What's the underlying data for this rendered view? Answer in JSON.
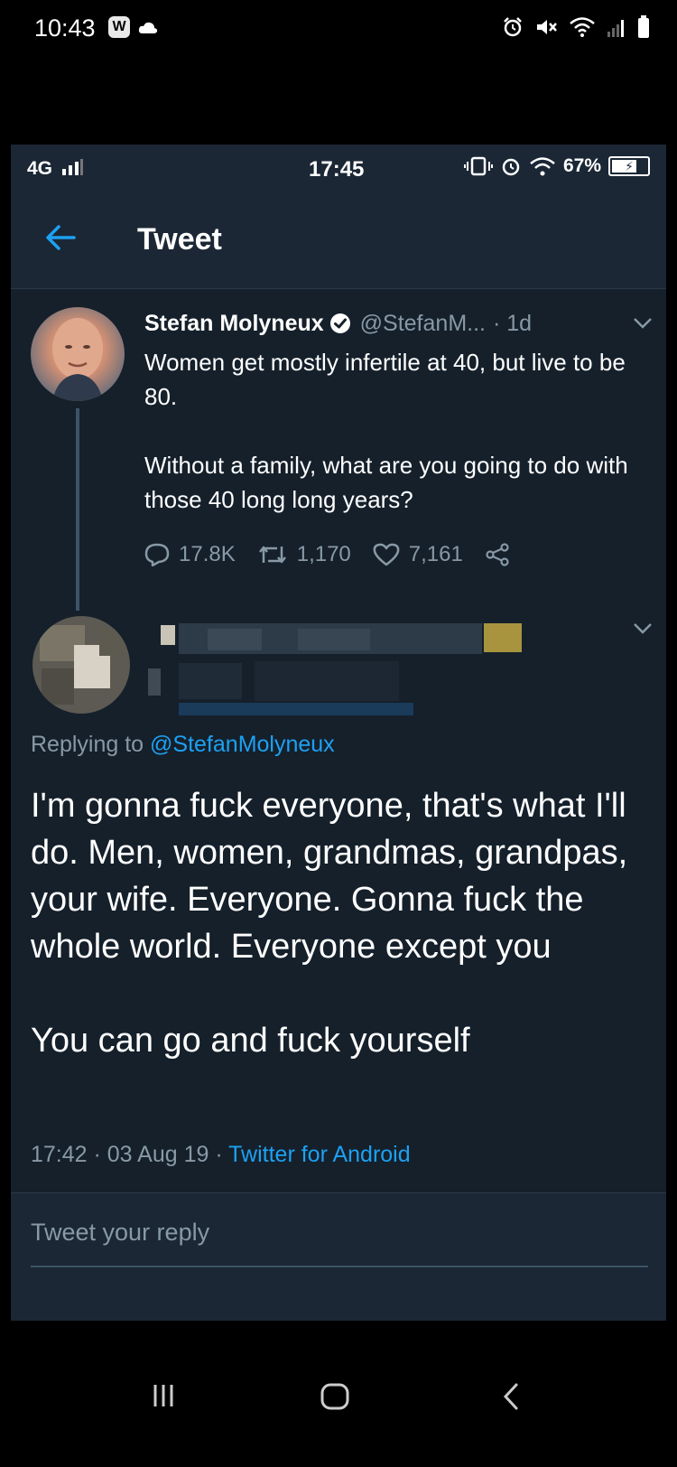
{
  "outer_status": {
    "time": "10:43",
    "app_badge": "W"
  },
  "inner_status": {
    "carrier": "4G",
    "time": "17:45",
    "battery": "67%"
  },
  "header": {
    "title": "Tweet"
  },
  "parent_tweet": {
    "author": "Stefan Molyneux",
    "handle": "@StefanM...",
    "time_ago": "· 1d",
    "text": "Women get mostly infertile at 40, but live to be 80.\n\nWithout a family, what are you going to do with those 40 long long years?",
    "replies": "17.8K",
    "retweets": "1,170",
    "likes": "7,161"
  },
  "reply": {
    "replying_prefix": "Replying to",
    "replying_to": "@StefanMolyneux",
    "text": "I'm gonna fuck everyone, that's what I'll do. Men, women, grandmas, grandpas, your wife. Everyone. Gonna fuck the whole world. Everyone except you\n\nYou can go and fuck yourself",
    "timestamp": "17:42 · 03 Aug 19 · ",
    "source": "Twitter for Android"
  },
  "reply_box": {
    "placeholder": "Tweet your reply"
  },
  "colors": {
    "background": "#15202b",
    "header": "#1b2735",
    "accent": "#1da1f2",
    "secondary_text": "#8899a6"
  }
}
